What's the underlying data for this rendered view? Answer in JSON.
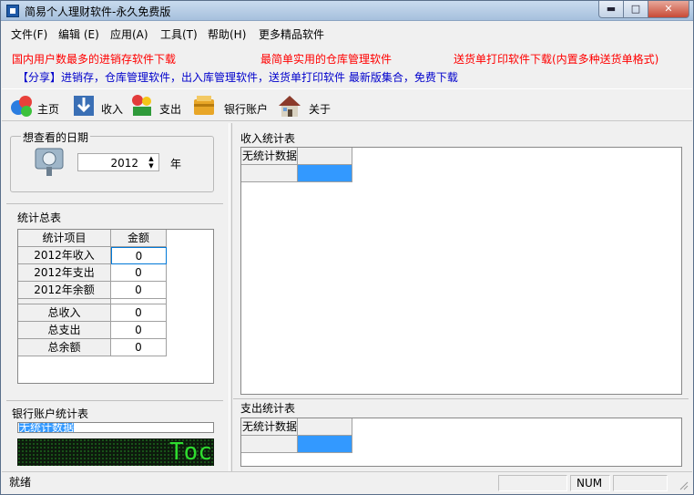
{
  "window": {
    "title": "简易个人理财软件-永久免费版",
    "min_label": "▬",
    "max_label": "□",
    "close_label": "✕"
  },
  "menu": [
    "文件(F)",
    "编辑 (E)",
    "应用(A)",
    "工具(T)",
    "帮助(H)",
    "更多精品软件"
  ],
  "ads": {
    "line1": [
      "国内用户数最多的进销存软件下载",
      "最简单实用的仓库管理软件",
      "送货单打印软件下载(内置多种送货单格式)"
    ],
    "line2": "【分享】进销存，仓库管理软件，出入库管理软件，送货单打印软件 最新版集合，免费下载"
  },
  "toolbar": [
    {
      "label": "主页",
      "icon": "home-page-icon"
    },
    {
      "label": "收入",
      "icon": "income-download-icon"
    },
    {
      "label": "支出",
      "icon": "expense-icon"
    },
    {
      "label": "银行账户",
      "icon": "bank-account-icon"
    },
    {
      "label": "关于",
      "icon": "about-house-icon"
    }
  ],
  "date_group": {
    "title": "想查看的日期",
    "year_value": "2012",
    "year_unit": "年"
  },
  "summary": {
    "title": "统计总表",
    "headers": [
      "统计项目",
      "金额"
    ],
    "rows": [
      {
        "item": "2012年收入",
        "amount": "0"
      },
      {
        "item": "2012年支出",
        "amount": "0"
      },
      {
        "item": "2012年余额",
        "amount": "0"
      },
      {
        "item": "总收入",
        "amount": "0"
      },
      {
        "item": "总支出",
        "amount": "0"
      },
      {
        "item": "总余额",
        "amount": "0"
      }
    ]
  },
  "bank_group": {
    "title": "银行账户统计表",
    "list_item": "无统计数据",
    "led_text": "Toc"
  },
  "income_table": {
    "title": "收入统计表",
    "header": "无统计数据"
  },
  "expense_table": {
    "title": "支出统计表",
    "header": "无统计数据"
  },
  "status": {
    "ready": "就绪",
    "num": "NUM"
  }
}
